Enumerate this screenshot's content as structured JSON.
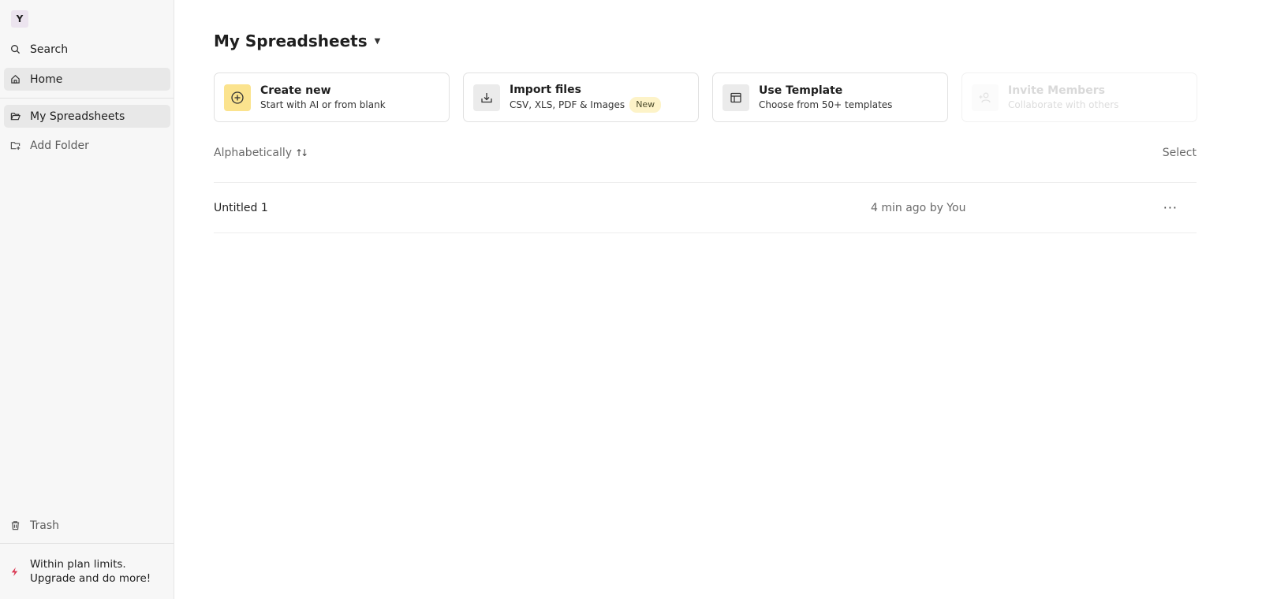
{
  "workspace": {
    "initial": "Y"
  },
  "sidebar": {
    "search": "Search",
    "home": "Home",
    "my_spreadsheets": "My Spreadsheets",
    "add_folder": "Add Folder",
    "trash": "Trash",
    "upgrade_line1": "Within plan limits.",
    "upgrade_line2": "Upgrade and do more!"
  },
  "main": {
    "title": "My Spreadsheets",
    "cards": [
      {
        "title": "Create new",
        "subtitle": "Start with AI or from blank"
      },
      {
        "title": "Import files",
        "subtitle": "CSV, XLS, PDF & Images",
        "badge": "New"
      },
      {
        "title": "Use Template",
        "subtitle": "Choose from 50+ templates"
      },
      {
        "title": "Invite Members",
        "subtitle": "Collaborate with others"
      }
    ],
    "sort_label": "Alphabetically",
    "select_label": "Select",
    "files": [
      {
        "name": "Untitled 1",
        "meta": "4 min ago by You"
      }
    ]
  },
  "colors": {
    "create_icon_bg": "#fbe38e",
    "icon_bg": "#ebebeb",
    "upgrade_icon": "#d9344f"
  }
}
